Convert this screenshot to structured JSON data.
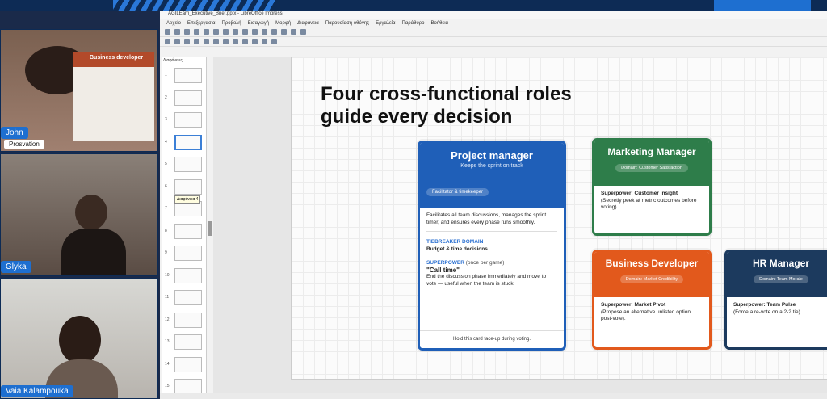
{
  "window": {
    "title": "AGILEarn_Executive_Brief.pptx - LibreOffice Impress"
  },
  "menu": [
    "Αρχείο",
    "Επεξεργασία",
    "Προβολή",
    "Εισαγωγή",
    "Μορφή",
    "Διαφάνεια",
    "Παρουσίαση οθόνης",
    "Εργαλεία",
    "Παράθυρο",
    "Βοήθεια"
  ],
  "panel": {
    "label": "Διαφάνειες",
    "tooltip": "Διαφάνεια 4",
    "slide_numbers": [
      "1",
      "2",
      "3",
      "4",
      "5",
      "6",
      "7",
      "8",
      "9",
      "10",
      "11",
      "12",
      "13",
      "14",
      "15"
    ],
    "selected": 4
  },
  "participants": [
    {
      "name": "John",
      "subtitle": "Prosvation",
      "card_title": "Business developer"
    },
    {
      "name": "Glyka"
    },
    {
      "name": "Vaia Kalampouka"
    }
  ],
  "slide": {
    "heading": "Four cross-functional roles guide every decision",
    "pm": {
      "title": "Project manager",
      "subtitle": "Keeps the sprint on track",
      "pill": "Facilitator & timekeeper",
      "desc": "Facilitates all team discussions, manages the sprint timer, and ensures every phase runs smoothly.",
      "domain_label": "TIEBREAKER DOMAIN",
      "domain_value": "Budget & time decisions",
      "power_label": "SUPERPOWER",
      "power_note": "(once per game)",
      "power_name": "\"Call time\"",
      "power_desc": "End the discussion phase immediately and move to vote — useful when the team is stuck.",
      "footer": "Hold this card face-up during voting."
    },
    "mm": {
      "title": "Marketing Manager",
      "pill": "Domain: Customer Satisfaction",
      "power": "Superpower: Customer Insight",
      "desc": "(Secretly peek at metric outcomes before voting)."
    },
    "bd": {
      "title": "Business Developer",
      "pill": "Domain: Market Credibility",
      "power": "Superpower: Market Pivot",
      "desc": "(Propose an alternative unlisted option post-vote)."
    },
    "hr": {
      "title": "HR Manager",
      "pill": "Domain: Team Morale",
      "power": "Superpower: Team Pulse",
      "desc": "(Force a re-vote on a 2-2 tie)."
    }
  },
  "colors": {
    "pm": "#1f5fb8",
    "mm": "#2e7d4a",
    "bd": "#e2591c",
    "hr": "#1c3a5e"
  }
}
